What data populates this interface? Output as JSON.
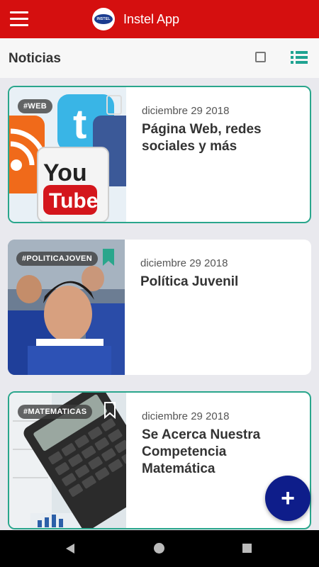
{
  "app_bar": {
    "title": "Instel App",
    "logo_text": "INSTEL",
    "menu_icon": "hamburger-icon"
  },
  "subheader": {
    "title": "Noticias",
    "select_icon": "checkbox-icon",
    "view_icon": "list-view-icon"
  },
  "colors": {
    "brand_red": "#d50f0f",
    "accent_teal": "#2aa68c",
    "fab_blue": "#0e1d8a"
  },
  "news": [
    {
      "tag": "#WEB",
      "date": "diciembre 29 2018",
      "title": "Página Web, redes sociales y más",
      "bookmarked": false,
      "outlined": true
    },
    {
      "tag": "#POLITICAJOVEN",
      "date": "diciembre 29 2018",
      "title": "Política Juvenil",
      "bookmarked": true,
      "outlined": false
    },
    {
      "tag": "#MATEMATICAS",
      "date": "diciembre 29 2018",
      "title": "Se Acerca Nuestra Competencia Matemática",
      "bookmarked": false,
      "outlined": true
    }
  ],
  "fab": {
    "label": "+"
  },
  "nav": {
    "back_icon": "back-icon",
    "home_icon": "home-icon",
    "recent_icon": "recent-apps-icon"
  }
}
